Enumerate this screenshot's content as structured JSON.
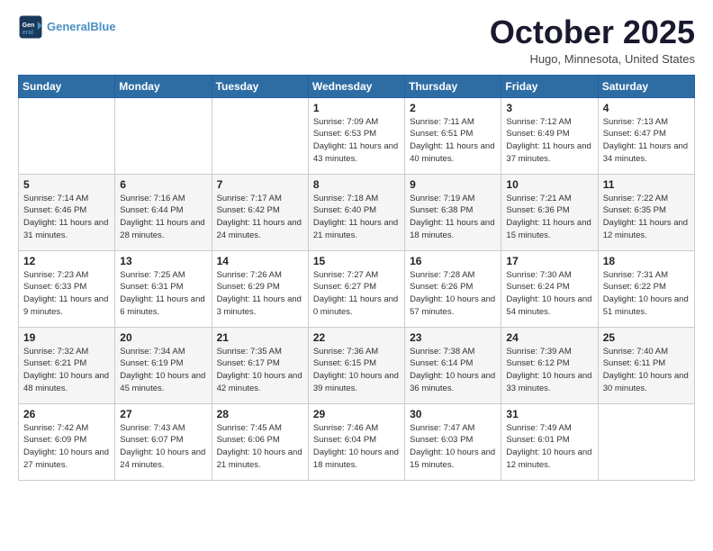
{
  "header": {
    "logo_line1": "General",
    "logo_line2": "Blue",
    "month_title": "October 2025",
    "location": "Hugo, Minnesota, United States"
  },
  "weekdays": [
    "Sunday",
    "Monday",
    "Tuesday",
    "Wednesday",
    "Thursday",
    "Friday",
    "Saturday"
  ],
  "weeks": [
    [
      {
        "day": "",
        "info": ""
      },
      {
        "day": "",
        "info": ""
      },
      {
        "day": "",
        "info": ""
      },
      {
        "day": "1",
        "info": "Sunrise: 7:09 AM\nSunset: 6:53 PM\nDaylight: 11 hours and 43 minutes."
      },
      {
        "day": "2",
        "info": "Sunrise: 7:11 AM\nSunset: 6:51 PM\nDaylight: 11 hours and 40 minutes."
      },
      {
        "day": "3",
        "info": "Sunrise: 7:12 AM\nSunset: 6:49 PM\nDaylight: 11 hours and 37 minutes."
      },
      {
        "day": "4",
        "info": "Sunrise: 7:13 AM\nSunset: 6:47 PM\nDaylight: 11 hours and 34 minutes."
      }
    ],
    [
      {
        "day": "5",
        "info": "Sunrise: 7:14 AM\nSunset: 6:46 PM\nDaylight: 11 hours and 31 minutes."
      },
      {
        "day": "6",
        "info": "Sunrise: 7:16 AM\nSunset: 6:44 PM\nDaylight: 11 hours and 28 minutes."
      },
      {
        "day": "7",
        "info": "Sunrise: 7:17 AM\nSunset: 6:42 PM\nDaylight: 11 hours and 24 minutes."
      },
      {
        "day": "8",
        "info": "Sunrise: 7:18 AM\nSunset: 6:40 PM\nDaylight: 11 hours and 21 minutes."
      },
      {
        "day": "9",
        "info": "Sunrise: 7:19 AM\nSunset: 6:38 PM\nDaylight: 11 hours and 18 minutes."
      },
      {
        "day": "10",
        "info": "Sunrise: 7:21 AM\nSunset: 6:36 PM\nDaylight: 11 hours and 15 minutes."
      },
      {
        "day": "11",
        "info": "Sunrise: 7:22 AM\nSunset: 6:35 PM\nDaylight: 11 hours and 12 minutes."
      }
    ],
    [
      {
        "day": "12",
        "info": "Sunrise: 7:23 AM\nSunset: 6:33 PM\nDaylight: 11 hours and 9 minutes."
      },
      {
        "day": "13",
        "info": "Sunrise: 7:25 AM\nSunset: 6:31 PM\nDaylight: 11 hours and 6 minutes."
      },
      {
        "day": "14",
        "info": "Sunrise: 7:26 AM\nSunset: 6:29 PM\nDaylight: 11 hours and 3 minutes."
      },
      {
        "day": "15",
        "info": "Sunrise: 7:27 AM\nSunset: 6:27 PM\nDaylight: 11 hours and 0 minutes."
      },
      {
        "day": "16",
        "info": "Sunrise: 7:28 AM\nSunset: 6:26 PM\nDaylight: 10 hours and 57 minutes."
      },
      {
        "day": "17",
        "info": "Sunrise: 7:30 AM\nSunset: 6:24 PM\nDaylight: 10 hours and 54 minutes."
      },
      {
        "day": "18",
        "info": "Sunrise: 7:31 AM\nSunset: 6:22 PM\nDaylight: 10 hours and 51 minutes."
      }
    ],
    [
      {
        "day": "19",
        "info": "Sunrise: 7:32 AM\nSunset: 6:21 PM\nDaylight: 10 hours and 48 minutes."
      },
      {
        "day": "20",
        "info": "Sunrise: 7:34 AM\nSunset: 6:19 PM\nDaylight: 10 hours and 45 minutes."
      },
      {
        "day": "21",
        "info": "Sunrise: 7:35 AM\nSunset: 6:17 PM\nDaylight: 10 hours and 42 minutes."
      },
      {
        "day": "22",
        "info": "Sunrise: 7:36 AM\nSunset: 6:15 PM\nDaylight: 10 hours and 39 minutes."
      },
      {
        "day": "23",
        "info": "Sunrise: 7:38 AM\nSunset: 6:14 PM\nDaylight: 10 hours and 36 minutes."
      },
      {
        "day": "24",
        "info": "Sunrise: 7:39 AM\nSunset: 6:12 PM\nDaylight: 10 hours and 33 minutes."
      },
      {
        "day": "25",
        "info": "Sunrise: 7:40 AM\nSunset: 6:11 PM\nDaylight: 10 hours and 30 minutes."
      }
    ],
    [
      {
        "day": "26",
        "info": "Sunrise: 7:42 AM\nSunset: 6:09 PM\nDaylight: 10 hours and 27 minutes."
      },
      {
        "day": "27",
        "info": "Sunrise: 7:43 AM\nSunset: 6:07 PM\nDaylight: 10 hours and 24 minutes."
      },
      {
        "day": "28",
        "info": "Sunrise: 7:45 AM\nSunset: 6:06 PM\nDaylight: 10 hours and 21 minutes."
      },
      {
        "day": "29",
        "info": "Sunrise: 7:46 AM\nSunset: 6:04 PM\nDaylight: 10 hours and 18 minutes."
      },
      {
        "day": "30",
        "info": "Sunrise: 7:47 AM\nSunset: 6:03 PM\nDaylight: 10 hours and 15 minutes."
      },
      {
        "day": "31",
        "info": "Sunrise: 7:49 AM\nSunset: 6:01 PM\nDaylight: 10 hours and 12 minutes."
      },
      {
        "day": "",
        "info": ""
      }
    ]
  ]
}
